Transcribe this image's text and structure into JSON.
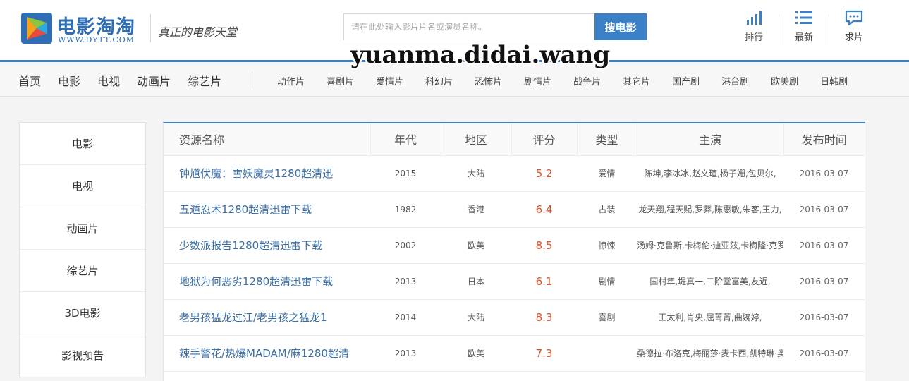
{
  "header": {
    "logo_cn": "电影淘淘",
    "logo_en": "WWW.DYTT.COM",
    "slogan": "真正的电影天堂",
    "search": {
      "placeholder": "请在此处输入影片片名或演员名称。",
      "button": "搜电影"
    },
    "quick_links": [
      {
        "label": "排行",
        "icon": "bar-chart-icon"
      },
      {
        "label": "最新",
        "icon": "list-icon"
      },
      {
        "label": "求片",
        "icon": "chat-icon"
      }
    ],
    "accent": "#3b7fc6"
  },
  "watermark": "yuanma.didai.wang",
  "nav": {
    "main": [
      "首页",
      "电影",
      "电视",
      "动画片",
      "综艺片"
    ],
    "sub": [
      "动作片",
      "喜剧片",
      "爱情片",
      "科幻片",
      "恐怖片",
      "剧情片",
      "战争片",
      "其它片",
      "国产剧",
      "港台剧",
      "欧美剧",
      "日韩剧"
    ]
  },
  "sidebar": {
    "items": [
      "电影",
      "电视",
      "动画片",
      "综艺片",
      "3D电影",
      "影视预告"
    ]
  },
  "table": {
    "headers": [
      "资源名称",
      "年代",
      "地区",
      "评分",
      "类型",
      "主演",
      "发布时间"
    ],
    "rows": [
      {
        "name": "钟馗伏魔：雪妖魔灵1280超清迅",
        "year": "2015",
        "region": "大陆",
        "score": "5.2",
        "genre": "爱情",
        "cast": "陈坤,李冰冰,赵文瑄,杨子姗,包贝尔,",
        "date": "2016-03-07"
      },
      {
        "name": "五遁忍术1280超清迅雷下载",
        "year": "1982",
        "region": "香港",
        "score": "6.4",
        "genre": "古装",
        "cast": "龙天翔,程天赐,罗莽,陈惠敏,朱客,王力,",
        "date": "2016-03-07"
      },
      {
        "name": "少数派报告1280超清迅雷下载",
        "year": "2002",
        "region": "欧美",
        "score": "8.5",
        "genre": "惊悚",
        "cast": "汤姆·克鲁斯,卡梅伦·迪亚兹,卡梅隆·克罗",
        "date": "2016-03-07"
      },
      {
        "name": "地狱为何恶劣1280超清迅雷下载",
        "year": "2013",
        "region": "日本",
        "score": "6.1",
        "genre": "剧情",
        "cast": "国村隼,堤真一,二阶堂富美,友近,",
        "date": "2016-03-07"
      },
      {
        "name": "老男孩猛龙过江/老男孩之猛龙1",
        "year": "2014",
        "region": "大陆",
        "score": "8.3",
        "genre": "喜剧",
        "cast": "王太利,肖央,屈菁菁,曲婉婷,",
        "date": "2016-03-07"
      },
      {
        "name": "辣手警花/热爆MADAM/麻1280超清",
        "year": "2013",
        "region": "欧美",
        "score": "7.3",
        "genre": "",
        "cast": "桑德拉·布洛克,梅丽莎·麦卡西,凯特琳·奥",
        "date": "2016-03-07"
      }
    ]
  }
}
